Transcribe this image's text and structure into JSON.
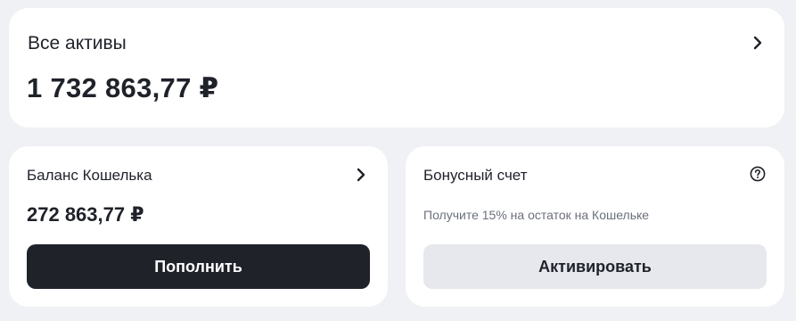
{
  "colors": {
    "background": "#f0f1f4",
    "card": "#ffffff",
    "text_primary": "#1f2229",
    "text_secondary": "#6b707b",
    "button_dark": "#1f2229",
    "button_light": "#e6e8ed"
  },
  "assets_card": {
    "title": "Все активы",
    "amount": "1 732 863,77 ₽",
    "icon": "chevron-right-icon"
  },
  "wallet_card": {
    "title": "Баланс Кошелька",
    "amount": "272 863,77 ₽",
    "icon": "chevron-right-icon",
    "button_label": "Пополнить"
  },
  "bonus_card": {
    "title": "Бонусный счет",
    "hint": "Получите 15% на остаток на Кошельке",
    "icon": "help-circle-icon",
    "button_label": "Активировать"
  }
}
